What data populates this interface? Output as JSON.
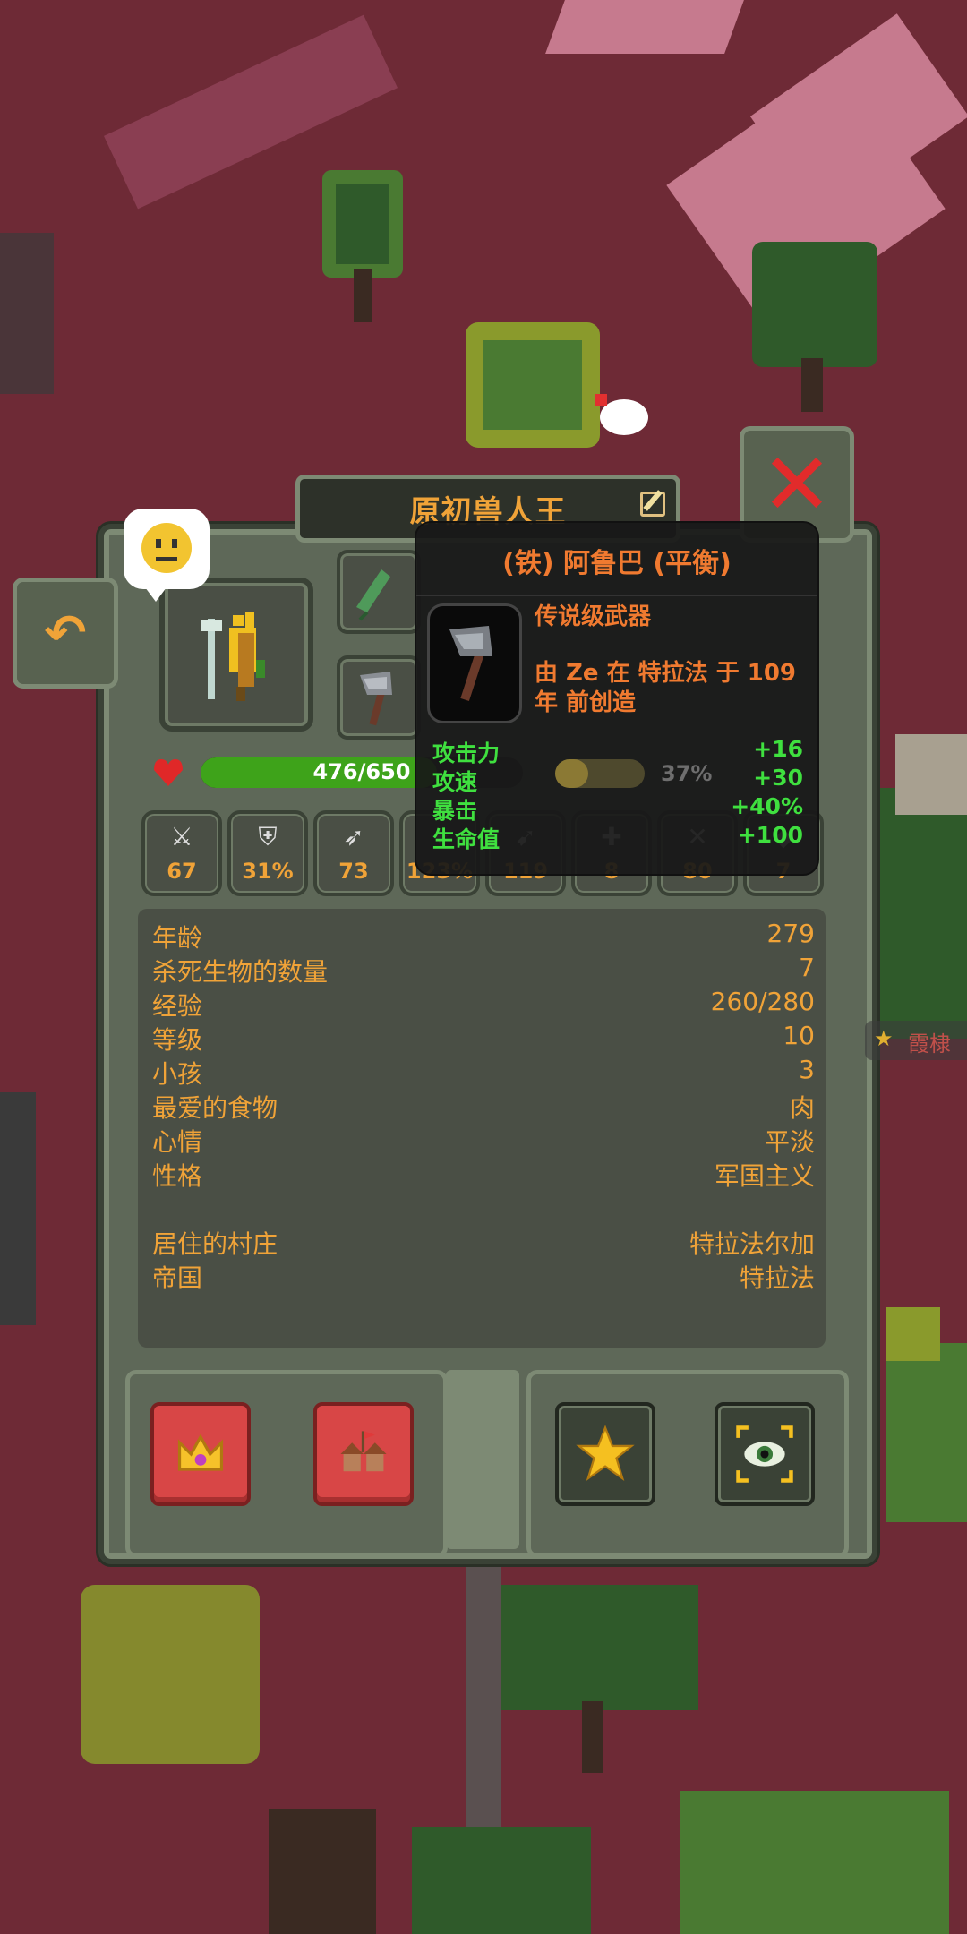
{
  "header": {
    "title": "原初兽人王"
  },
  "health": {
    "text": "476/650",
    "fraction": 0.733
  },
  "stats": [
    {
      "icon": "sword-icon",
      "value": "67"
    },
    {
      "icon": "shield-icon",
      "value": "31%"
    },
    {
      "icon": "wing-boot-icon",
      "value": "73"
    },
    {
      "icon": "critical-icon",
      "value": "123%"
    },
    {
      "icon": "range-icon",
      "value": "119"
    },
    {
      "icon": "armor-icon",
      "value": "8"
    },
    {
      "icon": "crossed-swords-icon",
      "value": "80"
    },
    {
      "icon": "misc-icon",
      "value": "7"
    }
  ],
  "hunger": {
    "text": "37%",
    "fraction": 0.37
  },
  "info": {
    "age": {
      "label": "年龄",
      "value": "279"
    },
    "kills": {
      "label": "杀死生物的数量",
      "value": "7"
    },
    "exp": {
      "label": "经验",
      "value": "260/280"
    },
    "level": {
      "label": "等级",
      "value": "10"
    },
    "children": {
      "label": "小孩",
      "value": "3"
    },
    "food": {
      "label": "最爱的食物",
      "value": "肉"
    },
    "mood": {
      "label": "心情",
      "value": "平淡"
    },
    "trait": {
      "label": "性格",
      "value": "军国主义"
    },
    "village": {
      "label": "居住的村庄",
      "value": "特拉法尔加"
    },
    "empire": {
      "label": "帝国",
      "value": "特拉法"
    }
  },
  "tooltip": {
    "title": "(铁) 阿鲁巴 (平衡)",
    "rarity": "传说级武器",
    "origin": "由 Ze 在 特拉法 于 109 年 前创造",
    "stats": [
      {
        "label": "攻击力",
        "value": "+16"
      },
      {
        "label": "攻速",
        "value": "+30"
      },
      {
        "label": "暴击",
        "value": "+40%"
      },
      {
        "label": "生命值",
        "value": "+100"
      }
    ]
  },
  "side_tag": "霞棣",
  "colors": {
    "accent": "#f0a338",
    "panel": "#5e6858",
    "health": "#3ea31a",
    "close": "#e22b2b",
    "tooltip_stat": "#3fe03f"
  }
}
